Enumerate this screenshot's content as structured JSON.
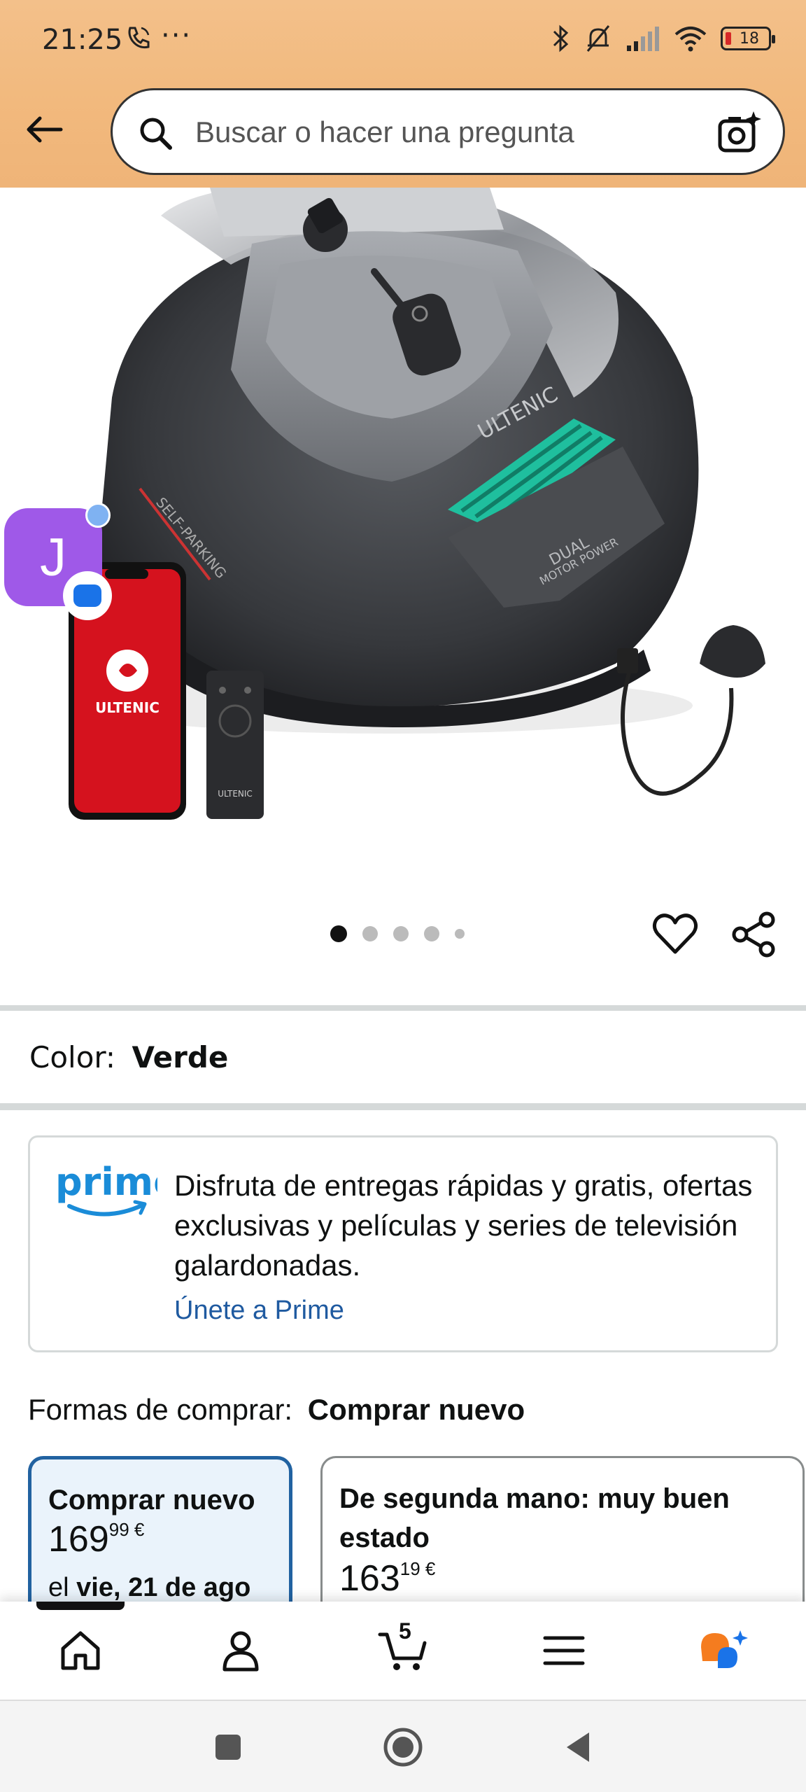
{
  "status_bar": {
    "time": "21:25",
    "more": "···",
    "battery": "18"
  },
  "search": {
    "placeholder": "Buscar o hacer una pregunta"
  },
  "product_image": {
    "brand_label_body": "ULTENIC",
    "side_label": "SELF-PARKING",
    "badge_label_1": "DUAL",
    "badge_label_2": "MOTOR POWER",
    "phone_label": "ULTENIC",
    "remote_label": "ULTENIC"
  },
  "assistant": {
    "letter": "J"
  },
  "gallery": {
    "total_images": 5,
    "active_index": 0
  },
  "color": {
    "label": "Color:",
    "value": "Verde"
  },
  "prime": {
    "logo_text": "prime",
    "description": "Disfruta de entregas rápidas y gratis, ofertas exclusivas y películas y series de televisión galardonadas.",
    "link": "Únete a Prime"
  },
  "ways_to_buy": {
    "label": "Formas de comprar:",
    "value": "Comprar nuevo"
  },
  "options": [
    {
      "title": "Comprar nuevo",
      "price_whole": "169",
      "price_fraction": "99",
      "currency": "€",
      "delivery_prefix": "el",
      "delivery_date": "vie, 21 de ago"
    },
    {
      "title": "De segunda mano: muy buen estado",
      "price_whole": "163",
      "price_fraction": "19",
      "currency": "€"
    }
  ],
  "bottom_nav": {
    "cart_count": "5",
    "items": [
      "home-icon",
      "account-icon",
      "cart-icon",
      "menu-icon",
      "rufus-icon"
    ]
  },
  "colors": {
    "header_bg": "#f2b97d",
    "prime_blue": "#1f5aa0",
    "selected_border": "#2162a1",
    "selected_bg": "#eaf3fb",
    "accent_teal": "#1fbf9e",
    "assistant_purple": "#9f59e8"
  }
}
